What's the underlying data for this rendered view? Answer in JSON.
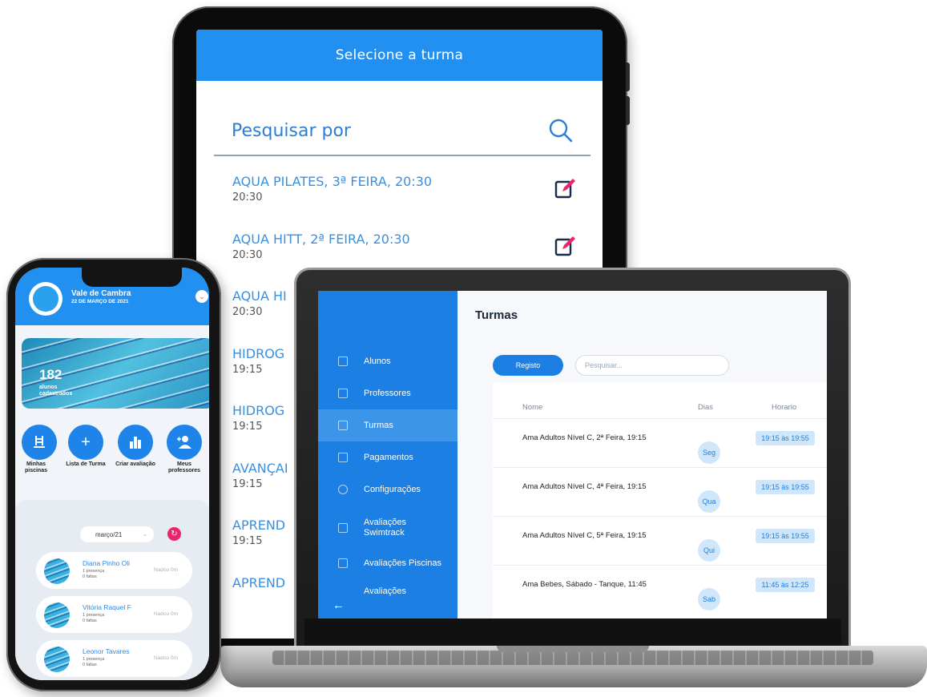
{
  "tablet": {
    "header_title": "Selecione a turma",
    "search_placeholder": "Pesquisar por",
    "classes": [
      {
        "title": "AQUA PILATES, 3ª FEIRA, 20:30",
        "time": "20:30"
      },
      {
        "title": "AQUA HITT, 2ª FEIRA, 20:30",
        "time": "20:30"
      },
      {
        "title": "AQUA HI",
        "time": "20:30"
      },
      {
        "title": "HIDROG",
        "time": "19:15"
      },
      {
        "title": "HIDROG",
        "time": "19:15"
      },
      {
        "title": "AVANÇAI",
        "time": "19:15"
      },
      {
        "title": "APREND",
        "time": "19:15"
      },
      {
        "title": "APREND",
        "time": ""
      }
    ],
    "colors": {
      "header": "#2190f0",
      "edit_icon": "#e8246a"
    }
  },
  "laptop": {
    "sidebar": {
      "items": [
        {
          "label": "Alunos",
          "icon": "users-icon"
        },
        {
          "label": "Professores",
          "icon": "teacher-icon"
        },
        {
          "label": "Turmas",
          "icon": "list-icon",
          "active": true
        },
        {
          "label": "Pagamentos",
          "icon": "card-icon"
        },
        {
          "label": "Configurações",
          "icon": "gear-icon"
        },
        {
          "label": "Avaliações Swimtrack",
          "icon": "chart-icon"
        },
        {
          "label": "Avaliações Piscinas",
          "icon": "chart-icon"
        },
        {
          "label": "Avaliações",
          "icon": "chart-icon"
        }
      ],
      "back_icon": "←"
    },
    "page_title": "Turmas",
    "register_button": "Registo",
    "search_placeholder": "Pesquisar...",
    "table": {
      "headers": {
        "name": "Nome",
        "days": "Dias",
        "time": "Horario"
      },
      "rows": [
        {
          "name": "Ama Adultos Nível C, 2ª Feira, 19:15",
          "day": "Seg",
          "time": "19:15 às 19:55"
        },
        {
          "name": "Ama Adultos Nível C, 4ª Feira, 19:15",
          "day": "Qua",
          "time": "19:15 às 19:55"
        },
        {
          "name": "Ama Adultos Nível C, 5ª Feira, 19:15",
          "day": "Qui",
          "time": "19:15 às 19:55"
        },
        {
          "name": "Ama Bebes, Sábado - Tanque, 11:45",
          "day": "Sab",
          "time": "11:45 às 12:25"
        }
      ]
    },
    "colors": {
      "sidebar": "#1b7fe3",
      "badge_bg": "#cfe6fb",
      "badge_text": "#2380df"
    }
  },
  "phone": {
    "club_name": "Vale de Cambra",
    "date": "22 DE MARÇO DE 2021",
    "student_count": "182",
    "student_count_label": "alunos cadastrados",
    "actions": [
      {
        "label": "Minhas piscinas",
        "icon": "pool-ladder-icon"
      },
      {
        "label": "Lista de Turma",
        "icon": "plus-icon"
      },
      {
        "label": "Criar avaliação",
        "icon": "bar-chart-icon"
      },
      {
        "label": "Meus professores",
        "icon": "add-user-icon"
      }
    ],
    "month_select": "março/21",
    "students": [
      {
        "name": "Diana Pinho Oli",
        "presence": "1 presença",
        "absences": "0 faltas",
        "swim": "Nadou 0m"
      },
      {
        "name": "Vitória Raquel F",
        "presence": "1 presença",
        "absences": "0 faltas",
        "swim": "Nadou 0m"
      },
      {
        "name": "Leonor Tavares",
        "presence": "1 presença",
        "absences": "0 faltas",
        "swim": "Nadou 0m"
      }
    ],
    "colors": {
      "header": "#2190f0",
      "action": "#1f84ea",
      "refresh": "#e8246a"
    }
  }
}
